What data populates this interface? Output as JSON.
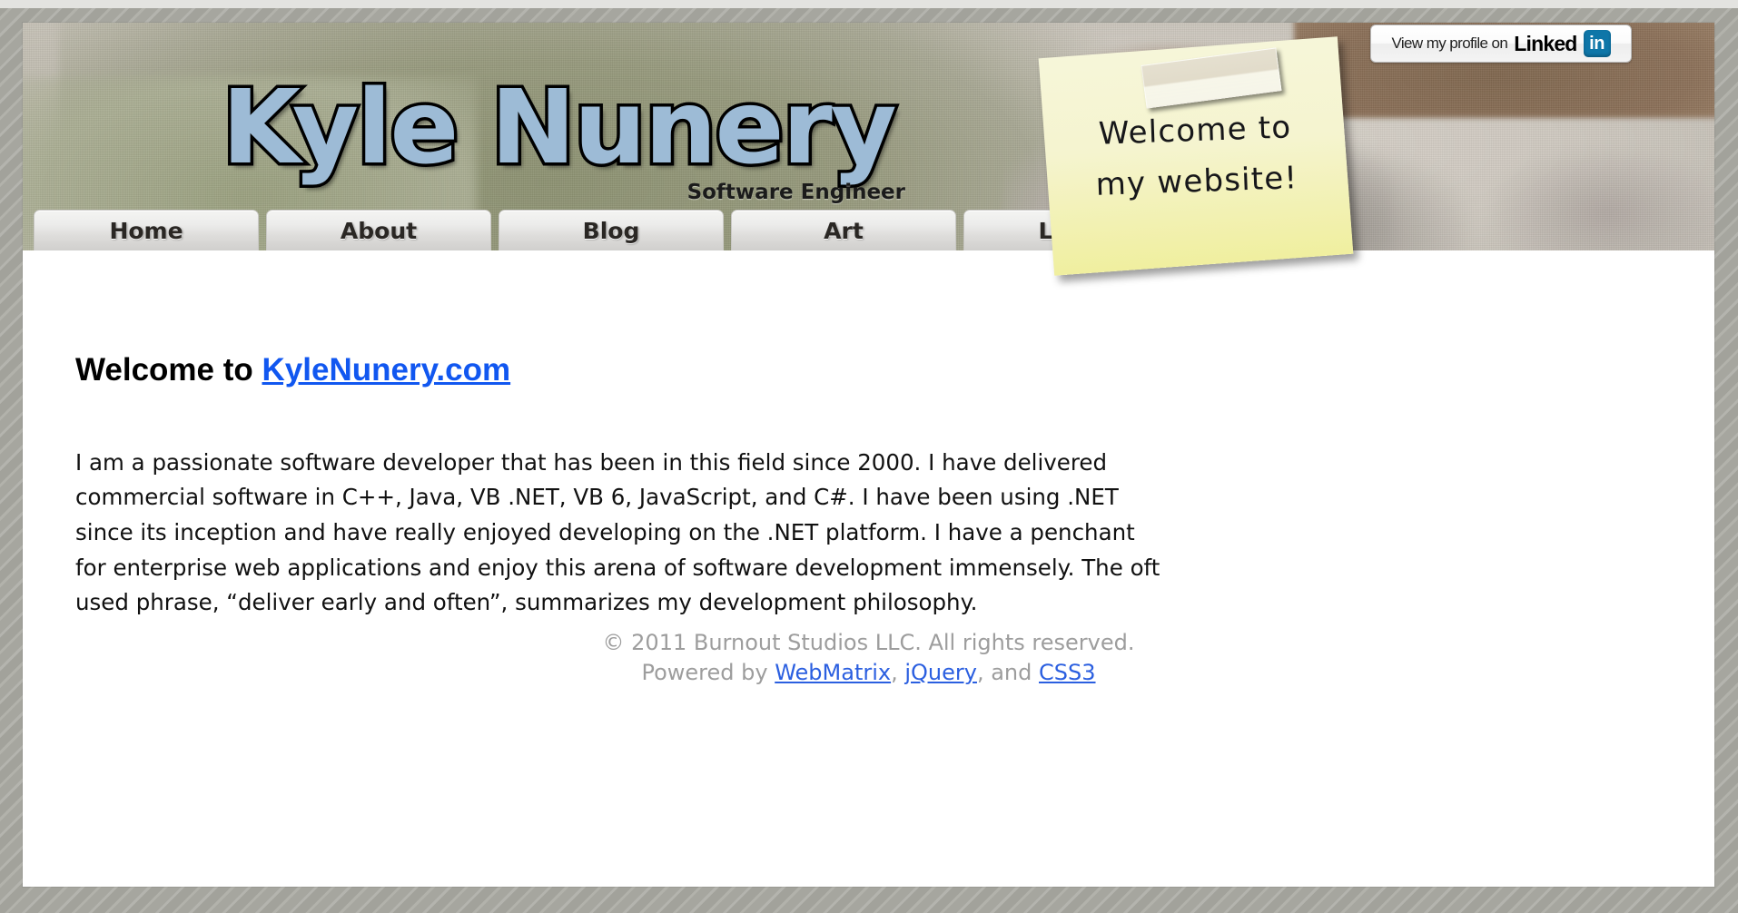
{
  "site": {
    "logo_title": "Kyle Nunery",
    "logo_subtitle": "Software Engineer",
    "accent_link_color": "#1157f0",
    "footer_link_color": "#2b5fe0",
    "logo_fill_color": "#9dbbd6",
    "linkedin_blue": "#0e76a8",
    "note_yellow": "#f5f4cf"
  },
  "linkedin_badge": {
    "prefix_text": "View my profile on",
    "brand_text": "Linked",
    "icon_text": "in"
  },
  "sticky_note": {
    "text": "Welcome to my website!"
  },
  "nav": {
    "tabs": [
      {
        "label": "Home"
      },
      {
        "label": "About"
      },
      {
        "label": "Blog"
      },
      {
        "label": "Art"
      },
      {
        "label": "Logos"
      }
    ]
  },
  "main": {
    "heading_prefix": "Welcome to ",
    "heading_link": "KyleNunery.com",
    "paragraph": "I am a passionate software developer that has been in this field since 2000. I have delivered commercial software in C++, Java, VB .NET, VB 6, JavaScript, and C#. I have been using .NET since its inception and have really enjoyed developing on the .NET platform. I have a penchant for enterprise web applications and enjoy this arena of software development immensely. The oft used phrase, “deliver early and often”, summarizes my development philosophy."
  },
  "footer": {
    "copyright": "© 2011 Burnout Studios LLC. All rights reserved.",
    "powered_prefix": "Powered by ",
    "link1": "WebMatrix",
    "sep1": ", ",
    "link2": "jQuery",
    "sep2": ", and ",
    "link3": "CSS3"
  }
}
